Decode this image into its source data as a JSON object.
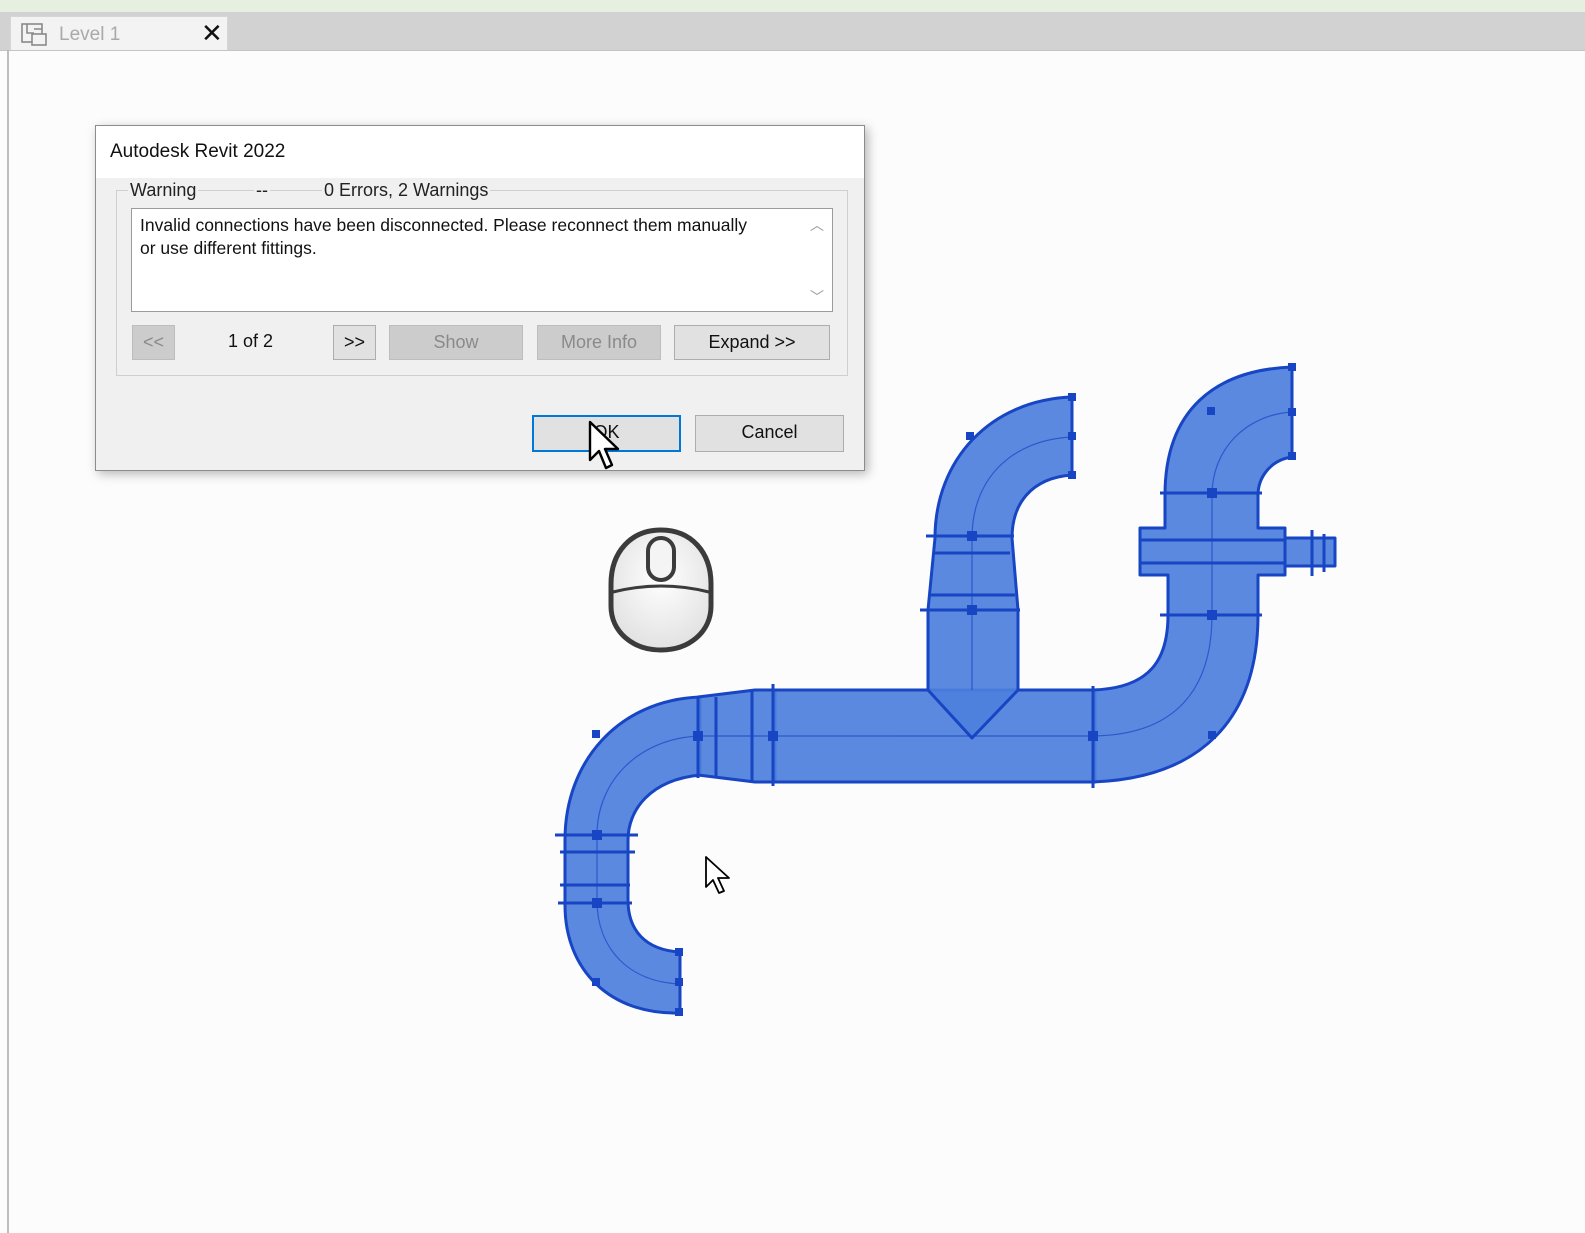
{
  "tab": {
    "label": "Level 1",
    "close": "✕"
  },
  "dialog": {
    "title": "Autodesk Revit 2022",
    "header": {
      "severity": "Warning",
      "separator": "--",
      "summary": "0 Errors, 2 Warnings"
    },
    "message": "Invalid connections have been disconnected. Please reconnect them manually\nor use different fittings.",
    "nav": {
      "prev": "<<",
      "counter": "1 of 2",
      "next": ">>"
    },
    "buttons": {
      "show": "Show",
      "more_info": "More Info",
      "expand": "Expand >>",
      "ok": "OK",
      "cancel": "Cancel"
    }
  },
  "colors": {
    "pipe_fill": "#4d7fdd",
    "pipe_stroke": "#1745c4",
    "accent": "#0078d7"
  }
}
